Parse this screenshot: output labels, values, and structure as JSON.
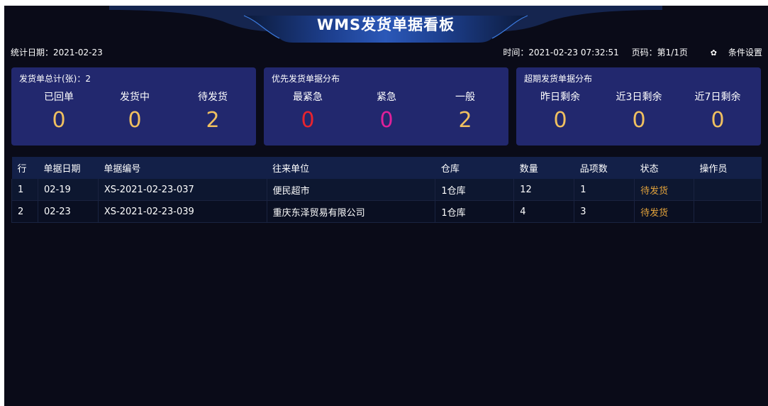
{
  "header": {
    "title": "WMS发货单据看板"
  },
  "topbar": {
    "stat_date": "统计日期：2021-02-23",
    "time": "时间：2021-02-23 07:32:51",
    "page": "页码：第1/1页",
    "settings_label": "条件设置"
  },
  "cards": {
    "total": {
      "title": "发货单总计(张)：2",
      "cols": [
        {
          "label": "已回单",
          "value": "0",
          "color": "#f0c060"
        },
        {
          "label": "发货中",
          "value": "0",
          "color": "#f0c060"
        },
        {
          "label": "待发货",
          "value": "2",
          "color": "#f0c060"
        }
      ]
    },
    "priority": {
      "title": "优先发货单据分布",
      "cols": [
        {
          "label": "最紧急",
          "value": "0",
          "color": "#e8232e"
        },
        {
          "label": "紧急",
          "value": "0",
          "color": "#e0209a"
        },
        {
          "label": "一般",
          "value": "2",
          "color": "#f0c060"
        }
      ]
    },
    "overdue": {
      "title": "超期发货单据分布",
      "cols": [
        {
          "label": "昨日剩余",
          "value": "0",
          "color": "#f0c060"
        },
        {
          "label": "近3日剩余",
          "value": "0",
          "color": "#f0c060"
        },
        {
          "label": "近7日剩余",
          "value": "0",
          "color": "#f0c060"
        }
      ]
    }
  },
  "table": {
    "headers": [
      "行",
      "单据日期",
      "单据编号",
      "往来单位",
      "仓库",
      "数量",
      "品项数",
      "状态",
      "操作员"
    ],
    "rows": [
      [
        "1",
        "02-19",
        "XS-2021-02-23-037",
        "便民超市",
        "1仓库",
        "12",
        "1",
        "待发货",
        ""
      ],
      [
        "2",
        "02-23",
        "XS-2021-02-23-039",
        "重庆东泽贸易有限公司",
        "1仓库",
        "4",
        "3",
        "待发货",
        ""
      ]
    ]
  },
  "icons": {
    "settings": "gear-icon"
  }
}
